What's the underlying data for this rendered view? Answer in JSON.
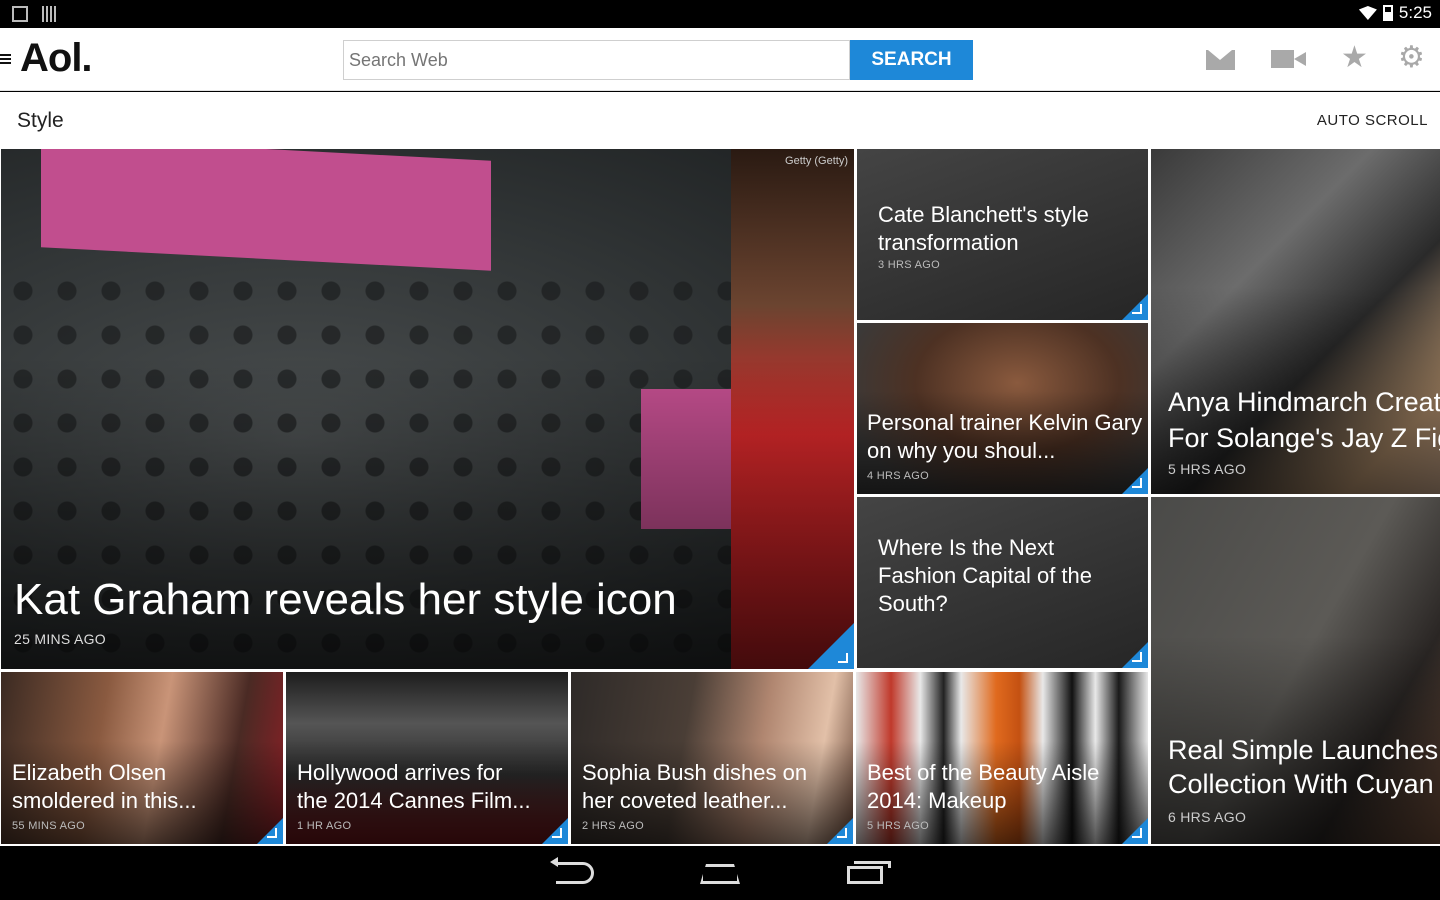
{
  "status": {
    "time": "5:25"
  },
  "header": {
    "logo": "Aol.",
    "search_placeholder": "Search Web",
    "search_button": "SEARCH"
  },
  "section": {
    "title": "Style",
    "auto_scroll": "AUTO SCROLL"
  },
  "tiles": {
    "hero": {
      "title": "Kat Graham reveals her style icon",
      "time": "25 MINS AGO",
      "credit": "Getty (Getty)"
    },
    "cate": {
      "title": "Cate Blanchett's style transformation",
      "time": "3 HRS AGO"
    },
    "kelvin": {
      "title": "Personal trainer Kelvin Gary on why you shoul...",
      "time": "4 HRS AGO"
    },
    "anya": {
      "title": "Anya Hindmarch Creat For Solange's Jay Z Fig",
      "time": "5 HRS AGO"
    },
    "fashion": {
      "title": "Where Is the Next Fashion Capital of the South?"
    },
    "elizabeth": {
      "title": "Elizabeth Olsen smoldered in this...",
      "time": "55 MINS AGO"
    },
    "cannes": {
      "title": "Hollywood arrives for the 2014 Cannes Film...",
      "time": "1 HR AGO"
    },
    "sophia": {
      "title": "Sophia Bush dishes on her coveted leather...",
      "time": "2 HRS AGO"
    },
    "beauty": {
      "title": "Best of the Beauty Aisle 2014: Makeup",
      "time": "5 HRS AGO"
    },
    "realsimple": {
      "title": "Real Simple Launches Collection With Cuyan",
      "time": "6 HRS AGO"
    }
  }
}
